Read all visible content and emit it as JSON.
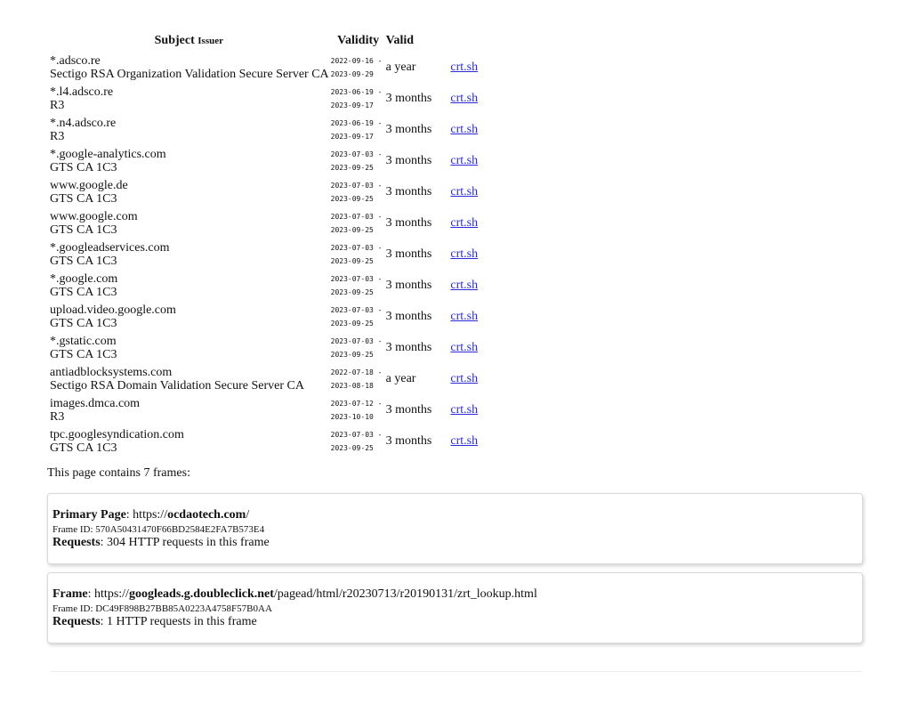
{
  "table": {
    "header": {
      "subject": "Subject",
      "issuer": "Issuer",
      "validity": "Validity",
      "valid": "Valid"
    },
    "rows": [
      {
        "subject": "*.adsco.re",
        "issuer": "Sectigo RSA Organization Validation Secure Server CA",
        "from": "2022-09-16 -",
        "to": "2023-09-29",
        "duration": "a year",
        "link": "crt.sh"
      },
      {
        "subject": "*.l4.adsco.re",
        "issuer": "R3",
        "from": "2023-06-19 -",
        "to": "2023-09-17",
        "duration": "3 months",
        "link": "crt.sh"
      },
      {
        "subject": "*.n4.adsco.re",
        "issuer": "R3",
        "from": "2023-06-19 -",
        "to": "2023-09-17",
        "duration": "3 months",
        "link": "crt.sh"
      },
      {
        "subject": "*.google-analytics.com",
        "issuer": "GTS CA 1C3",
        "from": "2023-07-03 -",
        "to": "2023-09-25",
        "duration": "3 months",
        "link": "crt.sh"
      },
      {
        "subject": "www.google.de",
        "issuer": "GTS CA 1C3",
        "from": "2023-07-03 -",
        "to": "2023-09-25",
        "duration": "3 months",
        "link": "crt.sh"
      },
      {
        "subject": "www.google.com",
        "issuer": "GTS CA 1C3",
        "from": "2023-07-03 -",
        "to": "2023-09-25",
        "duration": "3 months",
        "link": "crt.sh"
      },
      {
        "subject": "*.googleadservices.com",
        "issuer": "GTS CA 1C3",
        "from": "2023-07-03 -",
        "to": "2023-09-25",
        "duration": "3 months",
        "link": "crt.sh"
      },
      {
        "subject": "*.google.com",
        "issuer": "GTS CA 1C3",
        "from": "2023-07-03 -",
        "to": "2023-09-25",
        "duration": "3 months",
        "link": "crt.sh"
      },
      {
        "subject": "upload.video.google.com",
        "issuer": "GTS CA 1C3",
        "from": "2023-07-03 -",
        "to": "2023-09-25",
        "duration": "3 months",
        "link": "crt.sh"
      },
      {
        "subject": "*.gstatic.com",
        "issuer": "GTS CA 1C3",
        "from": "2023-07-03 -",
        "to": "2023-09-25",
        "duration": "3 months",
        "link": "crt.sh"
      },
      {
        "subject": "antiadblocksystems.com",
        "issuer": "Sectigo RSA Domain Validation Secure Server CA",
        "from": "2022-07-18 -",
        "to": "2023-08-18",
        "duration": "a year",
        "link": "crt.sh"
      },
      {
        "subject": "images.dmca.com",
        "issuer": "R3",
        "from": "2023-07-12 -",
        "to": "2023-10-10",
        "duration": "3 months",
        "link": "crt.sh"
      },
      {
        "subject": "tpc.googlesyndication.com",
        "issuer": "GTS CA 1C3",
        "from": "2023-07-03 -",
        "to": "2023-09-25",
        "duration": "3 months",
        "link": "crt.sh"
      }
    ]
  },
  "frames_note": "This page contains 7 frames:",
  "frames": [
    {
      "label": "Primary Page",
      "url_prefix": ": https://",
      "url_host": "ocdaotech.com",
      "url_path": "/",
      "frame_id_label": "Frame ID: 570A50431470F66BD2584E2FA7B573E4",
      "requests_label": "Requests",
      "requests_text": ": 304 HTTP requests in this frame"
    },
    {
      "label": "Frame",
      "url_prefix": ": https://",
      "url_host": "googleads.g.doubleclick.net",
      "url_path": "/pagead/html/r20230713/r20190131/zrt_lookup.html",
      "frame_id_label": "Frame ID: DC49F898B27BB85A0223A4758F57B0AA",
      "requests_label": "Requests",
      "requests_text": ": 1 HTTP requests in this frame"
    }
  ]
}
